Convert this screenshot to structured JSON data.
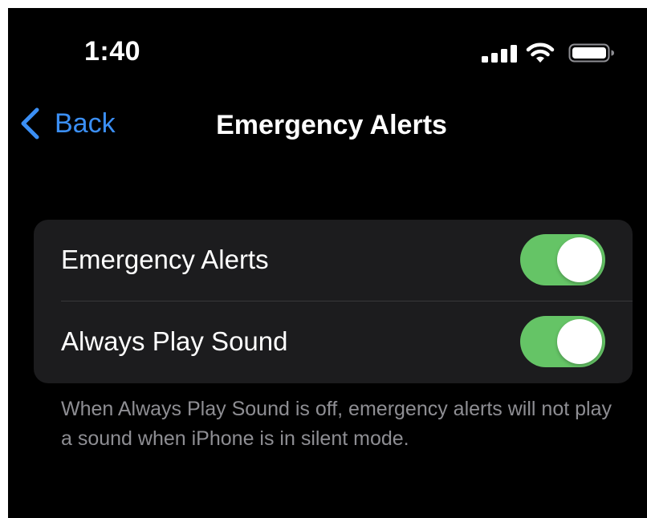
{
  "status_bar": {
    "time": "1:40",
    "icons": [
      "cellular-signal-icon",
      "wifi-icon",
      "battery-icon"
    ]
  },
  "nav": {
    "back_label": "Back",
    "title": "Emergency Alerts"
  },
  "settings": {
    "rows": [
      {
        "label": "Emergency Alerts",
        "enabled": true
      },
      {
        "label": "Always Play Sound",
        "enabled": true
      }
    ],
    "footer": "When Always Play Sound is off, emergency alerts will not play a sound when iPhone is in silent mode."
  },
  "colors": {
    "background": "#000000",
    "group_background": "#1c1c1e",
    "accent": "#3b8ff5",
    "toggle_on": "#65c466",
    "footer_text": "#8e8e93"
  }
}
